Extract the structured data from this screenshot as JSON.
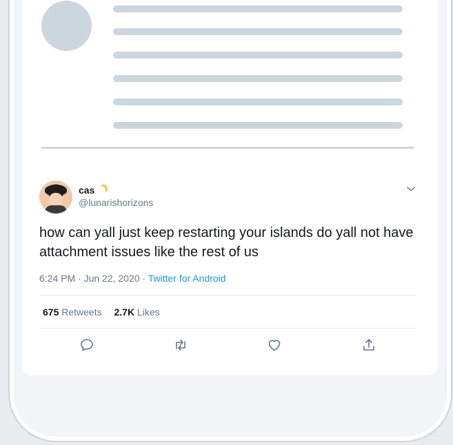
{
  "tweet": {
    "display_name": "cas",
    "emoji_icon": "crescent-moon-icon",
    "handle": "@lunarishorizons",
    "text": "how can yall just keep restarting your islands do yall not have attachment issues like the rest of us",
    "time_date": "6:24 PM · Jun 22, 2020 · ",
    "source": "Twitter for Android",
    "retweets_count": "675",
    "retweets_label": "Retweets",
    "likes_count": "2.7K",
    "likes_label": "Likes"
  },
  "actions": {
    "reply": "reply-icon",
    "retweet": "retweet-icon",
    "like": "heart-icon",
    "share": "share-icon"
  },
  "colors": {
    "skeleton": "#ccd6dd",
    "link": "#1b95e0",
    "secondary_text": "#657786",
    "primary_text": "#14171a"
  }
}
